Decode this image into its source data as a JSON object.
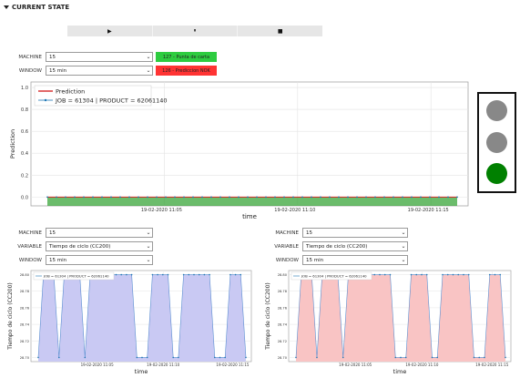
{
  "section": {
    "title": "CURRENT STATE"
  },
  "toolbar": {
    "play_icon": "▶",
    "pause_icon": "⏸",
    "stop_icon": "■"
  },
  "top_controls": {
    "machine_label": "MACHINE",
    "machine_value": "15",
    "window_label": "WINDOW",
    "window_value": "15 min",
    "badge_ok": {
      "text": "127 - Punta de carta",
      "color": "#2ecc40"
    },
    "badge_nok": {
      "text": "126 - Prediccion NOK",
      "color": "#ff3333"
    }
  },
  "traffic_light": {
    "lights": [
      "#888888",
      "#888888",
      "#008000"
    ]
  },
  "main_chart": {
    "type": "line",
    "ylabel": "Prediction",
    "xlabel": "time",
    "yticks": [
      "1.0",
      "0.8",
      "0.6",
      "0.4",
      "0.2",
      "0.0"
    ],
    "ylim": [
      -0.08,
      1.05
    ],
    "xticks": [
      "19-02-2020 11:05",
      "19-02-2020 11:10",
      "19-02-2020 11:15"
    ],
    "legend": [
      "Prediction",
      "JOB = 61304 | PRODUCT = 62061140"
    ],
    "prediction_color": "#d62728",
    "job_color": "#1f77b4",
    "prediction_values": [
      0,
      0,
      0,
      0,
      0,
      0,
      0,
      0,
      0,
      0,
      0,
      0,
      0,
      0,
      0,
      0,
      0,
      0,
      0,
      0,
      0,
      0,
      0,
      0,
      0,
      0,
      0,
      0,
      0,
      0,
      0,
      0,
      0,
      0,
      0,
      0,
      0,
      0,
      0,
      0,
      0,
      0,
      0,
      0,
      0,
      0
    ],
    "fill_color": "#2ca02c"
  },
  "left_panel": {
    "machine_label": "MACHINE",
    "machine_value": "15",
    "variable_label": "VARIABLE",
    "variable_value": "Tiempo de ciclo (CC200)",
    "window_label": "WINDOW",
    "window_value": "15 min",
    "chart": {
      "type": "area",
      "legend": "JOB = 61304 | PRODUCT = 62061140",
      "ylabel": "Tiempo de ciclo (CC200)",
      "xlabel": "time",
      "yticks": [
        "28.80",
        "28.78",
        "28.76",
        "28.74",
        "28.72",
        "28.70"
      ],
      "ylim": [
        28.695,
        28.805
      ],
      "xticks": [
        "19-02-2020 11:05",
        "19-02-2020 11:10",
        "19-02-2020 11:15"
      ],
      "fill_color": "#c9c9f3",
      "values": [
        28.7,
        28.8,
        28.8,
        28.8,
        28.7,
        28.8,
        28.8,
        28.8,
        28.8,
        28.7,
        28.8,
        28.8,
        28.8,
        28.8,
        28.8,
        28.8,
        28.8,
        28.8,
        28.8,
        28.7,
        28.7,
        28.7,
        28.8,
        28.8,
        28.8,
        28.8,
        28.7,
        28.7,
        28.8,
        28.8,
        28.8,
        28.8,
        28.8,
        28.8,
        28.7,
        28.7,
        28.7,
        28.8,
        28.8,
        28.8,
        28.7
      ]
    }
  },
  "right_panel": {
    "machine_label": "MACHINE",
    "machine_value": "15",
    "variable_label": "VARIABLE",
    "variable_value": "Tiempo de ciclo (CC200)",
    "window_label": "WINDOW",
    "window_value": "15 min",
    "chart": {
      "type": "area",
      "legend": "JOB = 61304 | PRODUCT = 62061140",
      "ylabel": "Tiempo de ciclo (CC200)",
      "xlabel": "time",
      "yticks": [
        "28.80",
        "28.78",
        "28.76",
        "28.74",
        "28.72",
        "28.70"
      ],
      "ylim": [
        28.695,
        28.805
      ],
      "xticks": [
        "19-02-2020 11:05",
        "19-02-2020 11:10",
        "19-02-2020 11:15"
      ],
      "fill_color": "#f9c4c4",
      "values": [
        28.7,
        28.8,
        28.8,
        28.8,
        28.7,
        28.8,
        28.8,
        28.8,
        28.8,
        28.7,
        28.8,
        28.8,
        28.8,
        28.8,
        28.8,
        28.8,
        28.8,
        28.8,
        28.8,
        28.7,
        28.7,
        28.7,
        28.8,
        28.8,
        28.8,
        28.8,
        28.7,
        28.7,
        28.8,
        28.8,
        28.8,
        28.8,
        28.8,
        28.8,
        28.7,
        28.7,
        28.7,
        28.8,
        28.8,
        28.8,
        28.7
      ]
    }
  }
}
